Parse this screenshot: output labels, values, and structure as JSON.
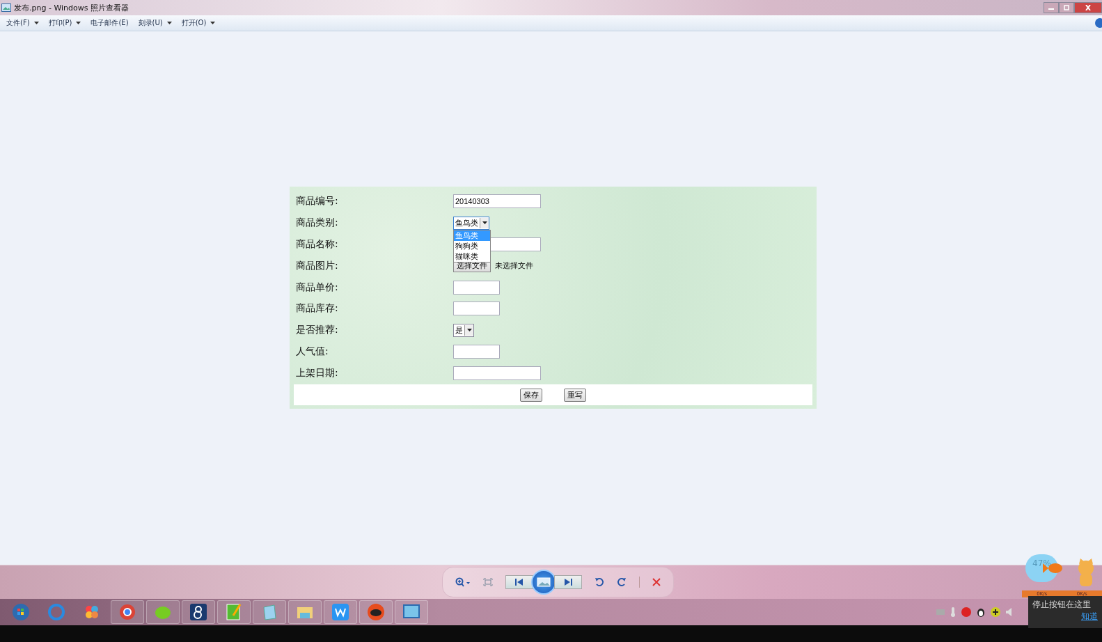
{
  "window": {
    "title": "发布.png - Windows 照片查看器"
  },
  "menu": [
    {
      "label": "文件(F)",
      "has_dropdown": true
    },
    {
      "label": "打印(P)",
      "has_dropdown": true
    },
    {
      "label": "电子邮件(E)",
      "has_dropdown": false
    },
    {
      "label": "刻录(U)",
      "has_dropdown": true
    },
    {
      "label": "打开(O)",
      "has_dropdown": true
    }
  ],
  "form": {
    "fields": [
      {
        "label": "商品编号:",
        "kind": "text",
        "value": "20140303"
      },
      {
        "label": "商品类别:",
        "kind": "select",
        "value": "鱼鸟类",
        "expanded": true,
        "options": [
          {
            "label": "鱼鸟类",
            "selected": true
          },
          {
            "label": "狗狗类",
            "selected": false
          },
          {
            "label": "猫咪类",
            "selected": false
          }
        ]
      },
      {
        "label": "商品名称:",
        "kind": "text"
      },
      {
        "label": "商品图片:",
        "kind": "file",
        "button": "选择文件",
        "status": "未选择文件"
      },
      {
        "label": "商品单价:",
        "kind": "short-text"
      },
      {
        "label": "商品库存:",
        "kind": "short-text"
      },
      {
        "label": "是否推荐:",
        "kind": "select",
        "value": "是",
        "expanded": false
      },
      {
        "label": "人气值:",
        "kind": "short-text"
      },
      {
        "label": "上架日期:",
        "kind": "text"
      }
    ],
    "buttons": [
      "保存",
      "重写"
    ]
  },
  "tray": {
    "widget_percent": "47%",
    "speeds": [
      "0K/s",
      "0K/s"
    ],
    "tooltip": {
      "text": "停止按钮在这里",
      "link": "知道"
    }
  }
}
